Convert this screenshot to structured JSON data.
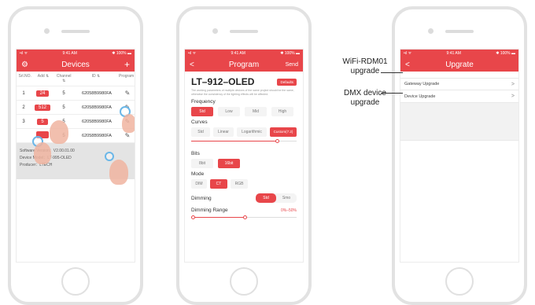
{
  "statusbar": {
    "signal": "•ıl ᯤ",
    "time": "9:41 AM",
    "battery": "✱ 100% ▬"
  },
  "devices": {
    "title": "Devices",
    "add_icon": "+",
    "headers": [
      "Srl.NO.",
      "Add ⇅",
      "Channel ⇅",
      "ID ⇅",
      "Program"
    ],
    "rows": [
      {
        "no": "1",
        "addr": "24",
        "channel": "5",
        "id": "62058B9980FA"
      },
      {
        "no": "2",
        "addr": "512",
        "channel": "5",
        "id": "62058B9980FA"
      },
      {
        "no": "3",
        "addr": "5",
        "channel": "5",
        "id": "62058B9980FA"
      },
      {
        "no": "4",
        "addr": "",
        "channel": "5",
        "id": "62058B9980FA"
      }
    ],
    "software_version": "Software Version：V2.00.01.00",
    "device_model": "Device Model：LT-995-OLED",
    "producer": "Producer：LTECH"
  },
  "program": {
    "title": "Program",
    "back": "<",
    "send": "Send",
    "model": "LT–912–OLED",
    "defaults": "Defaults",
    "note": "The working parameters of multiple devices of the same project should be the same, otherwise the consistency of the lighting effects will be affected.",
    "frequency": {
      "label": "Frequency",
      "options": [
        "Std",
        "Low",
        "Mid",
        "High"
      ],
      "selected": 0
    },
    "curves": {
      "label": "Curves",
      "options": [
        "Std",
        "Linear",
        "Logarithmic",
        "Custom(7.2)"
      ],
      "selected": 3,
      "slider_value": 0.8
    },
    "bits": {
      "label": "Bits",
      "options": [
        "8bit",
        "16bit"
      ],
      "selected": 1
    },
    "mode": {
      "label": "Mode",
      "options": [
        "DIM",
        "CT",
        "RGB"
      ],
      "selected": 1
    },
    "dimming": {
      "label": "Dimming",
      "options": [
        "Std",
        "Smo"
      ],
      "selected": 0
    },
    "dimming_range": {
      "label": "Dimming Range",
      "value": "0%–50%",
      "range": [
        0,
        0.5
      ]
    }
  },
  "upgrade": {
    "title": "Upgrate",
    "back": "<",
    "items": [
      "Gateway Upgrade",
      "Device Upgrade"
    ]
  },
  "callouts": {
    "wifi": [
      "WiFi-RDM01",
      "upgrade"
    ],
    "dmx": [
      "DMX device",
      "upgrade"
    ]
  },
  "colors": {
    "accent": "#e8464a",
    "touch": "#f0b4a0",
    "ring": "#6bb7e8"
  }
}
